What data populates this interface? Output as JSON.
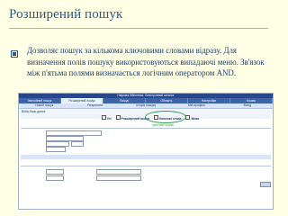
{
  "slide": {
    "title": "Розширений пошук",
    "body": "Дозволяє пошук за кількома ключовими словами відразу. Для визначення полів пошуку використовуються випадаючі меню. Зв'язок між п'ятьма полями визначається логічним оператором AND."
  },
  "screenshot": {
    "header_text": "Наукова бібліотека. Електронний каталог",
    "tabs": [
      "Звичайний пошук",
      "Розширений пошук",
      "Пошук",
      "Область",
      "Настройки",
      "Кошик"
    ],
    "subtabs": [
      "Новий пошук",
      "Результати",
      "Історія пошуку",
      "Мій профіль",
      "Вихід"
    ],
    "path": "Вибір бази даних",
    "options": [
      "Усі",
      "Тільки в заголовках",
      "Розширений пошук",
      "Ключові слова",
      "Мови"
    ],
    "note": "простий пошук",
    "accent_color": "#2fa04a"
  }
}
